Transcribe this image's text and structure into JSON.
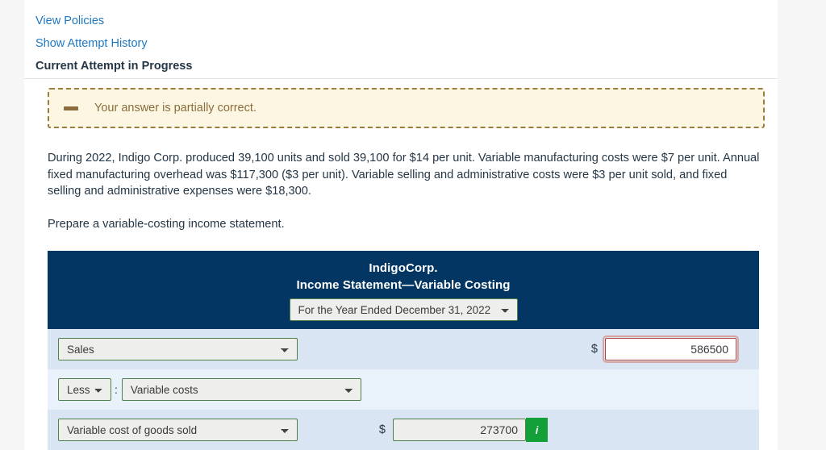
{
  "links": {
    "view_policies": "View Policies",
    "show_attempt_history": "Show Attempt History"
  },
  "attempt_heading": "Current Attempt in Progress",
  "alert": {
    "icon": "minus-icon",
    "message": "Your answer is partially correct."
  },
  "problem": {
    "paragraph": "During 2022, Indigo Corp. produced 39,100 units and sold 39,100 for $14 per unit. Variable manufacturing costs were $7 per unit. Annual fixed manufacturing overhead was $117,300 ($3 per unit). Variable selling and administrative costs were $3 per unit sold, and fixed selling and administrative expenses were $18,300.",
    "instruction": "Prepare a variable-costing income statement."
  },
  "statement": {
    "company": "IndigoCorp.",
    "title": "Income Statement—Variable Costing",
    "period_selected": "For the Year Ended December 31, 2022",
    "rows": [
      {
        "account": "Sales",
        "currency_symbol": "$",
        "amount": "586500",
        "status": "incorrect"
      },
      {
        "modifier": "Less",
        "separator": ":",
        "account": "Variable costs"
      },
      {
        "account": "Variable cost of goods sold",
        "currency_symbol": "$",
        "amount": "273700",
        "status": "correct",
        "badge_icon": "info-icon",
        "badge_label": "i"
      }
    ]
  },
  "colors": {
    "link": "#1f78c1",
    "header_navy": "#033663",
    "alert_bg": "#fcf6e3",
    "alert_border": "#9a7c3d",
    "row_odd": "#d9e5f2",
    "row_even": "#e9f1fb",
    "correct_green": "#14a038",
    "incorrect_red": "#a94442",
    "field_border_green": "#4f7f4a"
  }
}
